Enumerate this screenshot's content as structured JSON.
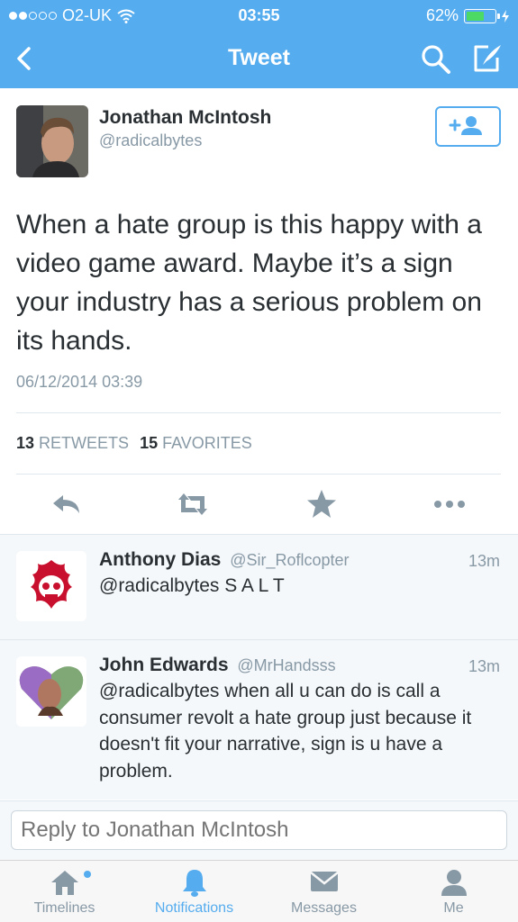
{
  "status_bar": {
    "carrier": "O2-UK",
    "time": "03:55",
    "battery": "62%",
    "battery_level": 0.62
  },
  "nav": {
    "title": "Tweet",
    "back_icon": "chevron-left-icon",
    "search_icon": "search-icon",
    "compose_icon": "compose-icon"
  },
  "tweet": {
    "author_name": "Jonathan McIntosh",
    "author_handle": "@radicalbytes",
    "text": "When a hate group is this happy with a video game award. Maybe it’s a sign your industry has a serious problem on its hands.",
    "timestamp": "06/12/2014 03:39",
    "retweets_count": "13",
    "retweets_label": "RETWEETS",
    "favorites_count": "15",
    "favorites_label": "FAVORITES"
  },
  "replies": [
    {
      "name": "Anthony Dias",
      "handle": "@Sir_Roflcopter",
      "time": "13m",
      "text": "@radicalbytes S A L T"
    },
    {
      "name": "John Edwards",
      "handle": "@MrHandsss",
      "time": "13m",
      "text": "@radicalbytes when all u can do is call a consumer revolt a hate group just because it doesn't fit your narrative, sign is u have a problem."
    }
  ],
  "reply_box": {
    "placeholder": "Reply to Jonathan McIntosh"
  },
  "tabs": [
    {
      "label": "Timelines",
      "icon": "home-icon",
      "active": false
    },
    {
      "label": "Notifications",
      "icon": "bell-icon",
      "active": true
    },
    {
      "label": "Messages",
      "icon": "envelope-icon",
      "active": false
    },
    {
      "label": "Me",
      "icon": "person-icon",
      "active": false
    }
  ],
  "colors": {
    "accent": "#55acee",
    "text": "#292f33",
    "muted": "#8899a6"
  }
}
